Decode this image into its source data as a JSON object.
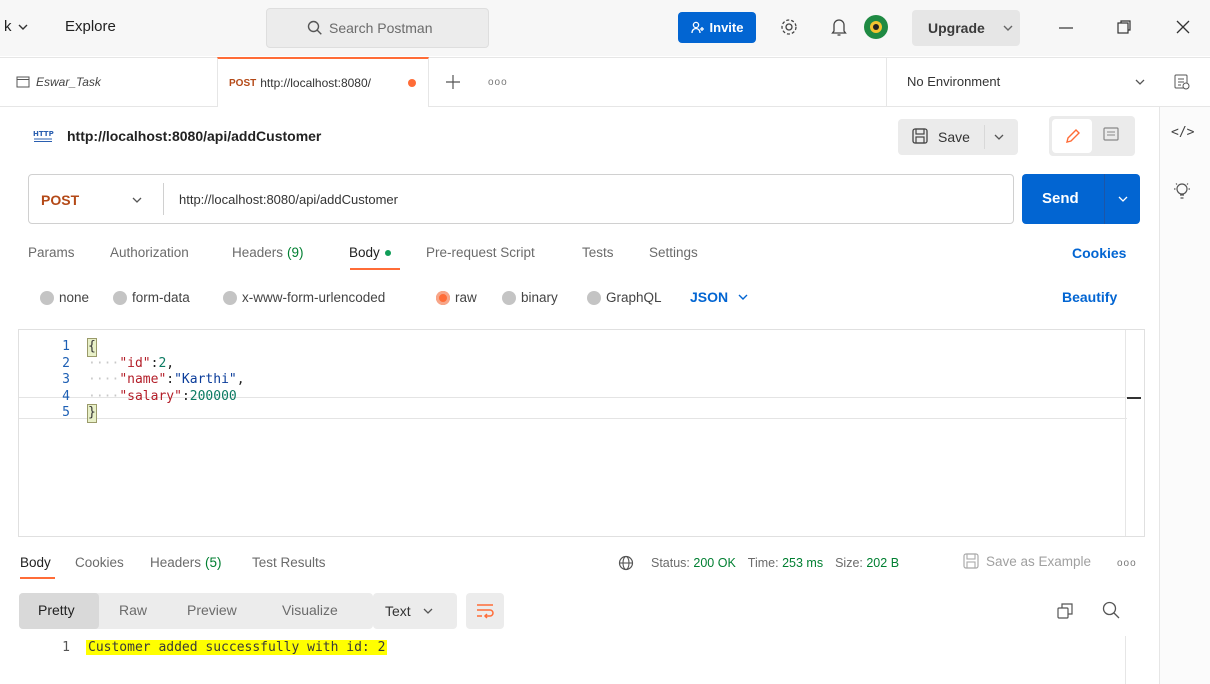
{
  "topbar": {
    "app_fragment": "k",
    "explore_label": "Explore",
    "search_placeholder": "Search Postman",
    "invite_label": "Invite",
    "upgrade_label": "Upgrade"
  },
  "tabs": {
    "collection_tab": "Eswar_Task",
    "active_tab_method": "POST",
    "active_tab_url": "http://localhost:8080/",
    "more_label": "ooo",
    "environment": "No Environment"
  },
  "request": {
    "title": "http://localhost:8080/api/addCustomer",
    "save_label": "Save",
    "method": "POST",
    "url": "http://localhost:8080/api/addCustomer",
    "send_label": "Send"
  },
  "request_tabs": [
    {
      "label": "Params"
    },
    {
      "label": "Authorization"
    },
    {
      "label": "Headers",
      "count": "(9)"
    },
    {
      "label": "Body"
    },
    {
      "label": "Pre-request Script"
    },
    {
      "label": "Tests"
    },
    {
      "label": "Settings"
    }
  ],
  "cookies_label": "Cookies",
  "body_types": [
    "none",
    "form-data",
    "x-www-form-urlencoded",
    "raw",
    "binary",
    "GraphQL"
  ],
  "selected_body_type": "raw",
  "body_format": "JSON",
  "beautify_label": "Beautify",
  "editor_lines": [
    {
      "n": "1",
      "text": "{"
    },
    {
      "n": "2",
      "key": "\"id\"",
      "sep": ":",
      "value": "2",
      "trail": ","
    },
    {
      "n": "3",
      "key": "\"name\"",
      "sep": ":",
      "value": "\"Karthi\"",
      "trail": ","
    },
    {
      "n": "4",
      "key": "\"salary\"",
      "sep": ":",
      "value": "200000",
      "trail": ""
    },
    {
      "n": "5",
      "text": "}"
    }
  ],
  "response": {
    "tabs": [
      "Body",
      "Cookies",
      "Headers",
      "Test Results"
    ],
    "headers_count": "(5)",
    "status_label": "Status:",
    "status_value": "200 OK",
    "time_label": "Time:",
    "time_value": "253 ms",
    "size_label": "Size:",
    "size_value": "202 B",
    "save_example_label": "Save as Example",
    "more_label": "ooo",
    "view_modes": [
      "Pretty",
      "Raw",
      "Preview",
      "Visualize"
    ],
    "format": "Text",
    "line_number": "1",
    "body_text": "Customer added successfully with id: 2"
  },
  "colors": {
    "accent_orange": "#ff6c37",
    "send_blue": "#0265d2",
    "link_blue": "#0265d2",
    "status_green": "#007f31",
    "highlight_yellow": "#ffff00"
  }
}
